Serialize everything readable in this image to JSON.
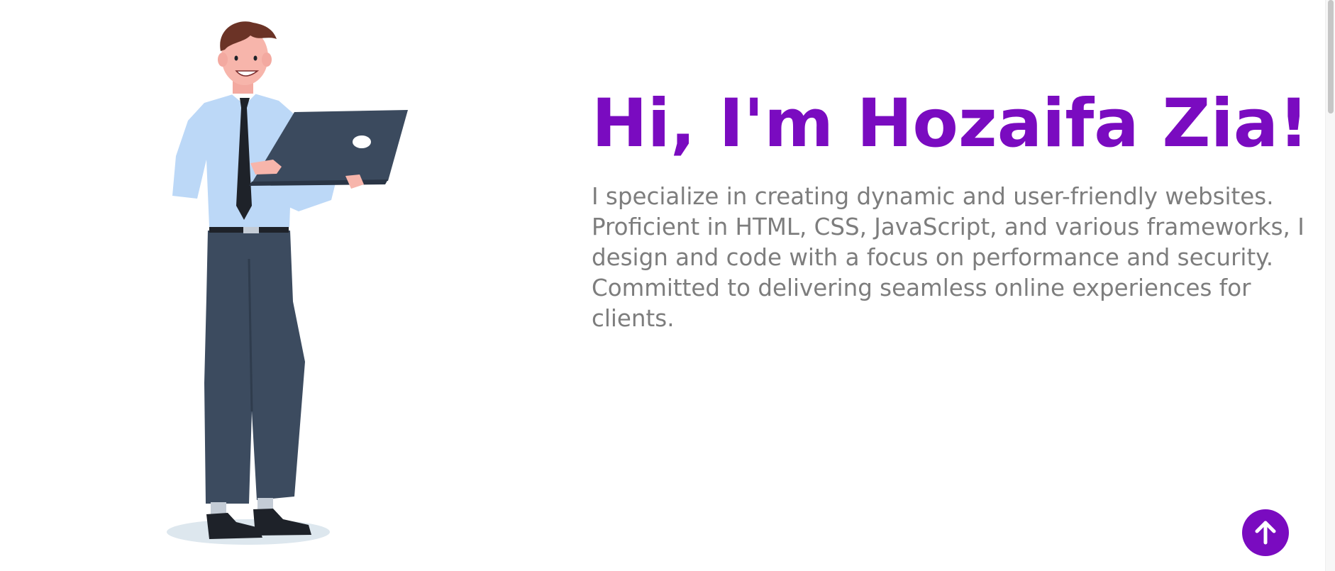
{
  "hero": {
    "title": "Hi, I'm Hozaifa Zia!",
    "bio": "I specialize in creating dynamic and user-friendly websites. Proficient in HTML, CSS, JavaScript, and various frameworks, I design and code with a focus on performance and security. Committed to delivering seamless online experiences for clients.",
    "illustration": "businessman-with-laptop-illustration"
  },
  "scroll_top": {
    "icon": "arrow-up-icon"
  },
  "colors": {
    "accent": "#7a0bc0",
    "body_text": "#7d7d7d",
    "background": "#ffffff"
  }
}
